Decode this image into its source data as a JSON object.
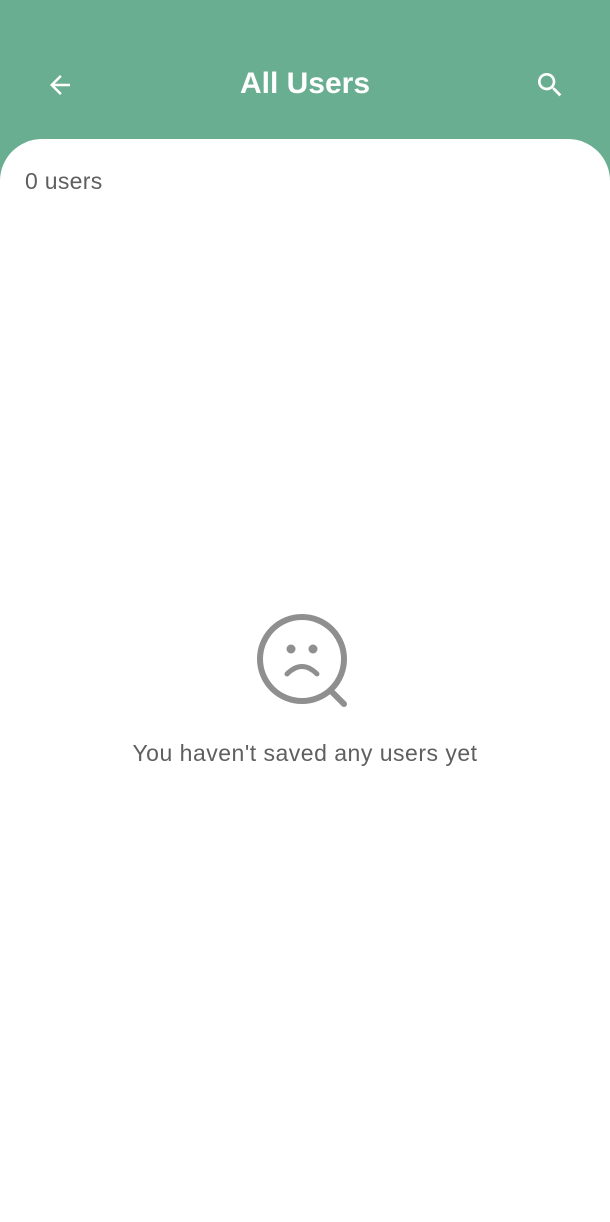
{
  "header": {
    "title": "All Users",
    "back_icon": "arrow-left-icon",
    "search_icon": "search-icon"
  },
  "content": {
    "count_text": "0 users",
    "empty_icon": "sad-search-icon",
    "empty_message": "You haven't saved any users yet"
  },
  "colors": {
    "accent": "#6aae91",
    "surface": "#ffffff",
    "text_secondary": "#5f5f5f",
    "icon_muted": "#8f8f8f"
  }
}
